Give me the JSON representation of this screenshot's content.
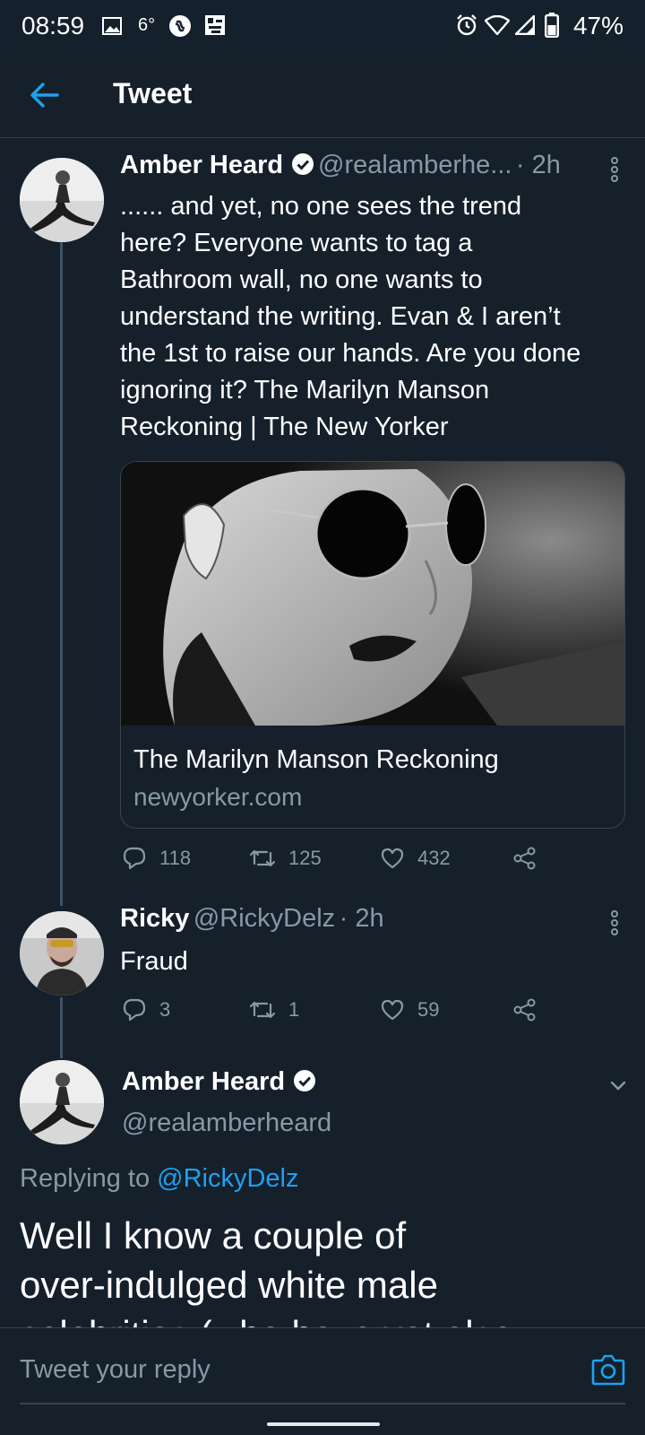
{
  "status_bar": {
    "time": "08:59",
    "temperature": "6°",
    "battery": "47%"
  },
  "header": {
    "title": "Tweet"
  },
  "tweet1": {
    "name": "Amber Heard",
    "handle": "@realamberhe...",
    "time": "· 2h",
    "lines": [
      "...... and yet, no one sees the trend",
      "here? Everyone wants to tag a",
      "Bathroom wall, no one wants to",
      "understand the writing. Evan & I aren’t",
      "the 1st to raise our hands. Are you done",
      "ignoring it?  The Marilyn Manson",
      "Reckoning | The New Yorker"
    ],
    "card": {
      "title": "The Marilyn Manson Reckoning",
      "domain": "newyorker.com"
    },
    "replies": "118",
    "retweets": "125",
    "likes": "432"
  },
  "tweet2": {
    "name": "Ricky",
    "handle": "@RickyDelz",
    "time": "· 2h",
    "text": "Fraud",
    "replies": "3",
    "retweets": "1",
    "likes": "59"
  },
  "main_tweet": {
    "name": "Amber Heard",
    "handle": "@realamberheard",
    "replying_prefix": "Replying to ",
    "replying_to": "@RickyDelz",
    "lines": [
      "Well I know a couple of",
      "over-indulged white male",
      "celebrities (who have yet also"
    ]
  },
  "composer": {
    "placeholder": "Tweet your reply"
  },
  "colors": {
    "background": "#15202b",
    "accent": "#1da1f2",
    "muted": "#8899a6",
    "divider": "#38444d"
  }
}
